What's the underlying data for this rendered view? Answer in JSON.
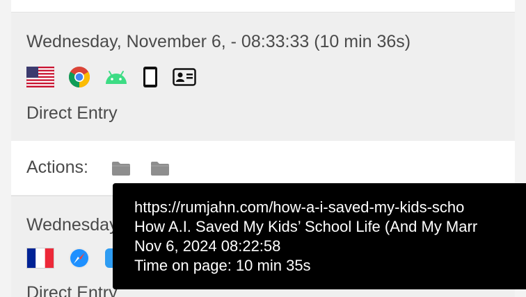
{
  "visits": [
    {
      "title": "Wednesday, November 6, - 08:33:33 (10 min 36s)",
      "icons": [
        "us-flag-icon",
        "chrome-icon",
        "android-icon",
        "smartphone-icon",
        "id-card-icon"
      ],
      "source": "Direct Entry"
    },
    {
      "title": "Wednesday",
      "icons": [
        "france-flag-icon",
        "safari-icon",
        "finder-icon"
      ],
      "source": "Direct Entry"
    }
  ],
  "actions": {
    "label": "Actions:",
    "items": [
      "folder-icon",
      "folder-icon"
    ]
  },
  "tooltip": {
    "url": "https://rumjahn.com/how-a-i-saved-my-kids-scho",
    "title": "How A.I. Saved My Kids’ School Life (And My Marr",
    "datetime": "Nov 6, 2024 08:22:58",
    "time_on_page": "Time on page: 10 min 35s"
  },
  "colors": {
    "card_bg": "#efefef",
    "text": "#4a4a4a",
    "folder": "#8e8e8e",
    "tooltip_bg": "#000000",
    "android_green": "#3ddc84"
  }
}
